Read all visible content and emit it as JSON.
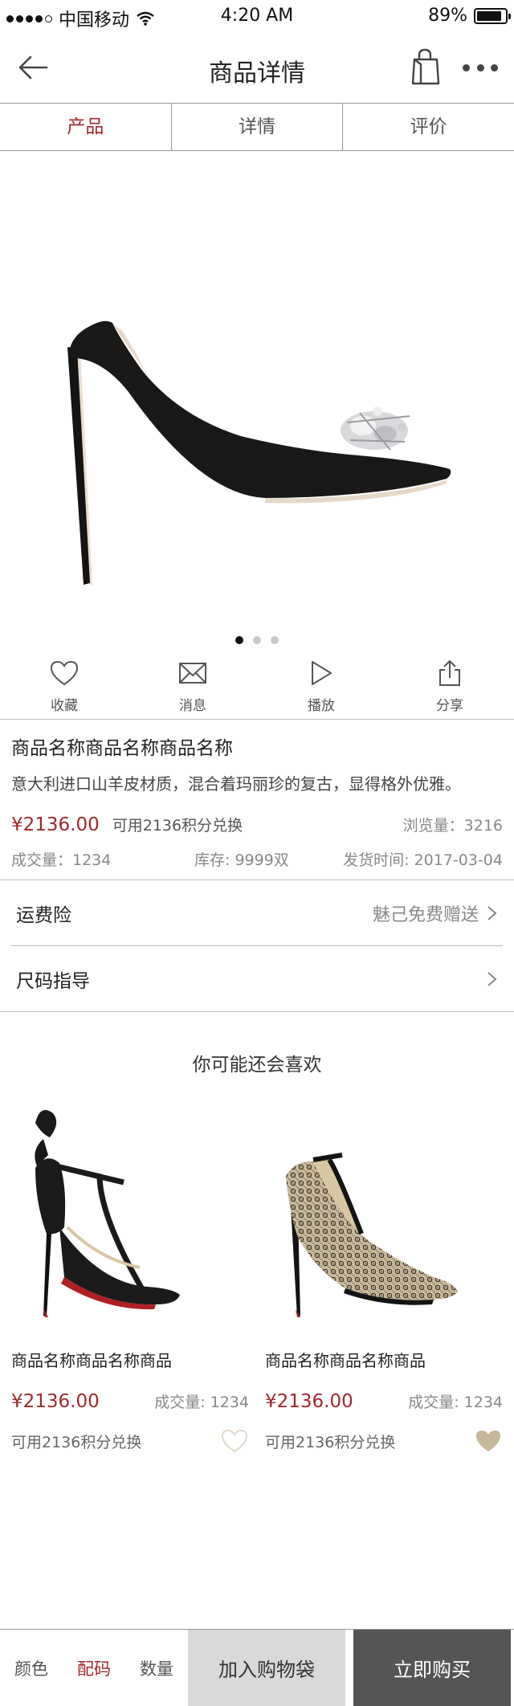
{
  "status_bar": {
    "carrier": "中国移动",
    "time": "4:20 AM",
    "battery": "89%",
    "battery_level": 0.89,
    "signal_icon": "signal-dots-icon",
    "wifi_icon": "wifi-icon"
  },
  "nav": {
    "title": "商品详情",
    "back_icon": "arrow-left-icon",
    "bag_icon": "shopping-bag-icon",
    "more_icon": "more-dots-icon"
  },
  "tabs": [
    {
      "label": "产品",
      "active": true
    },
    {
      "label": "详情",
      "active": false
    },
    {
      "label": "评价",
      "active": false
    }
  ],
  "carousel": {
    "count": 3,
    "active_index": 0
  },
  "actions": [
    {
      "label": "收藏",
      "icon": "heart-icon"
    },
    {
      "label": "消息",
      "icon": "mail-icon"
    },
    {
      "label": "播放",
      "icon": "play-icon"
    },
    {
      "label": "分享",
      "icon": "share-icon"
    }
  ],
  "product": {
    "name": "商品名称商品名称商品名称",
    "description": "意大利进口山羊皮材质，混合着玛丽珍的复古，显得格外优雅。",
    "price": "¥2136.00",
    "points": "可用2136积分兑换",
    "views": "浏览量：3216",
    "sales": "成交量：1234",
    "stock": "库存: 9999双",
    "ship_time": "发货时间: 2017-03-04"
  },
  "rows": [
    {
      "label": "运费险",
      "value": "魅己免费赠送"
    },
    {
      "label": "尺码指导",
      "value": ""
    }
  ],
  "recommend": {
    "title": "你可能还会喜欢",
    "items": [
      {
        "name": "商品名称商品名称商品",
        "price": "¥2136.00",
        "sales": "成交量: 1234",
        "points": "可用2136积分兑换",
        "liked": false
      },
      {
        "name": "商品名称商品名称商品",
        "price": "¥2136.00",
        "sales": "成交量: 1234",
        "points": "可用2136积分兑换",
        "liked": true
      }
    ]
  },
  "bottom_bar": {
    "options": [
      {
        "label": "颜色",
        "active": false
      },
      {
        "label": "配码",
        "active": true
      },
      {
        "label": "数量",
        "active": false
      }
    ],
    "add_to_cart": "加入购物袋",
    "buy_now": "立即购买"
  },
  "colors": {
    "accent": "#a0282c",
    "buy_button": "#555555",
    "cart_button": "#d9d9d9",
    "liked_heart": "#c8b89a"
  }
}
